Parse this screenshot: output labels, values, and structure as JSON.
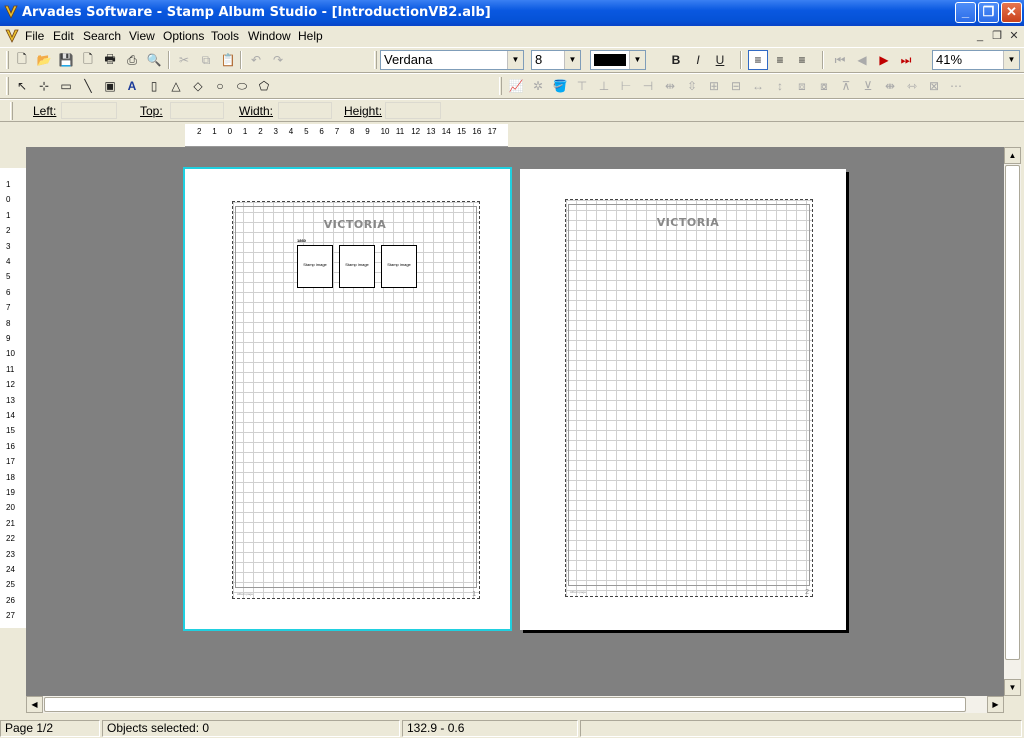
{
  "window": {
    "title": "Arvades Software - Stamp Album Studio - [IntroductionVB2.alb]"
  },
  "menu": [
    "File",
    "Edit",
    "Search",
    "View",
    "Options",
    "Tools",
    "Window",
    "Help"
  ],
  "format": {
    "font": "Verdana",
    "size": "8",
    "zoom": "41%",
    "color": "#000000"
  },
  "props": {
    "left_label": "Left:",
    "top_label": "Top:",
    "width_label": "Width:",
    "height_label": "Height:"
  },
  "ruler": {
    "h_ticks": [
      "2",
      "1",
      "0",
      "1",
      "2",
      "3",
      "4",
      "5",
      "6",
      "7",
      "8",
      "9",
      "10",
      "11",
      "12",
      "13",
      "14",
      "15",
      "16",
      "17"
    ],
    "v_ticks": [
      "1",
      "0",
      "1",
      "2",
      "3",
      "4",
      "5",
      "6",
      "7",
      "8",
      "9",
      "10",
      "11",
      "12",
      "13",
      "14",
      "15",
      "16",
      "17",
      "18",
      "19",
      "20",
      "21",
      "22",
      "23",
      "24",
      "25",
      "26",
      "27"
    ]
  },
  "pages": [
    {
      "title": "VICTORIA",
      "number": "1",
      "footer": "Album page",
      "selected": true,
      "stamps": [
        {
          "label": "Stamp image"
        },
        {
          "label": "Stamp image"
        },
        {
          "label": "Stamp image"
        }
      ],
      "stamp_heading": "1860"
    },
    {
      "title": "VICTORIA",
      "number": "2",
      "footer": "Album page",
      "selected": false,
      "stamps": []
    }
  ],
  "status": {
    "page": "Page 1/2",
    "selected": "Objects selected: 0",
    "coords": "132.9 - 0.6"
  }
}
